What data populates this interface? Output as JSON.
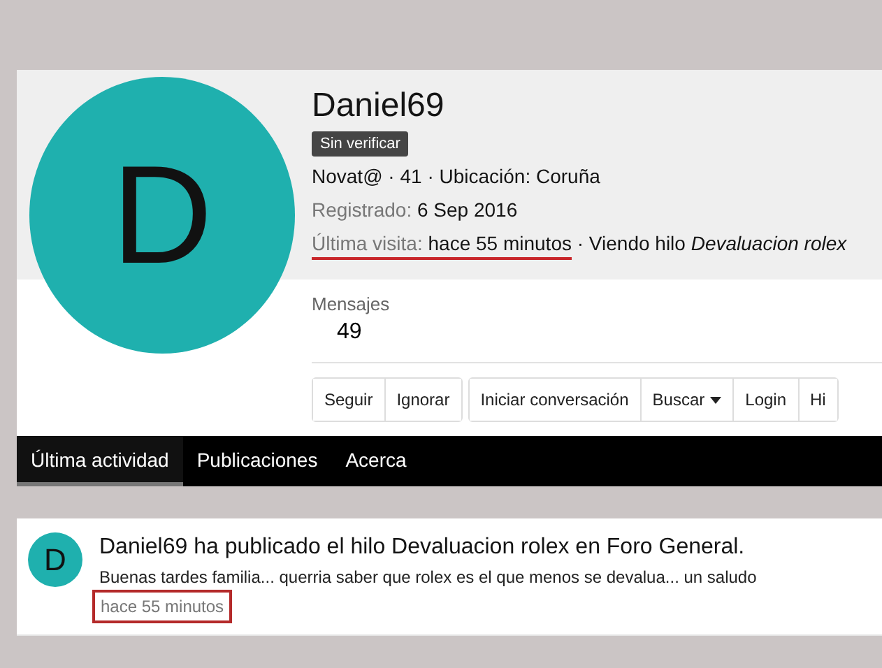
{
  "profile": {
    "avatar_letter": "D",
    "username": "Daniel69",
    "badge": "Sin verificar",
    "info": "Novat@ · 41 · Ubicación: Coruña",
    "registered": {
      "label": "Registrado:",
      "value": "6 Sep 2016"
    },
    "last_visit": {
      "label": "Última visita:",
      "value": "hace 55 minutos",
      "extra": "· Viendo hilo *Devaluacion rolex*",
      "underlined": true
    },
    "stats": [
      {
        "label": "Mensajes",
        "value": "49"
      }
    ],
    "button_groups": [
      [
        {
          "label": "Seguir",
          "kind": "plain"
        },
        {
          "label": "Ignorar",
          "kind": "plain"
        }
      ],
      [
        {
          "label": "Iniciar conversación",
          "kind": "plain"
        },
        {
          "label": "Buscar",
          "kind": "dropdown"
        },
        {
          "label": "Login",
          "kind": "plain"
        },
        {
          "label": "Hi",
          "kind": "plain"
        }
      ]
    ]
  },
  "tabs": [
    {
      "label": "Última actividad",
      "selected": true
    },
    {
      "label": "Publicaciones",
      "selected": false
    },
    {
      "label": "Acerca",
      "selected": false
    }
  ],
  "activity": [
    {
      "avatar_letter": "D",
      "title": "Daniel69 ha publicado el hilo Devaluacion rolex en Foro General.",
      "snippet": "Buenas tardes familia... querria saber que rolex es el que menos se devalua... un saludo",
      "time": "hace 55 minutos",
      "boxed": true
    }
  ]
}
